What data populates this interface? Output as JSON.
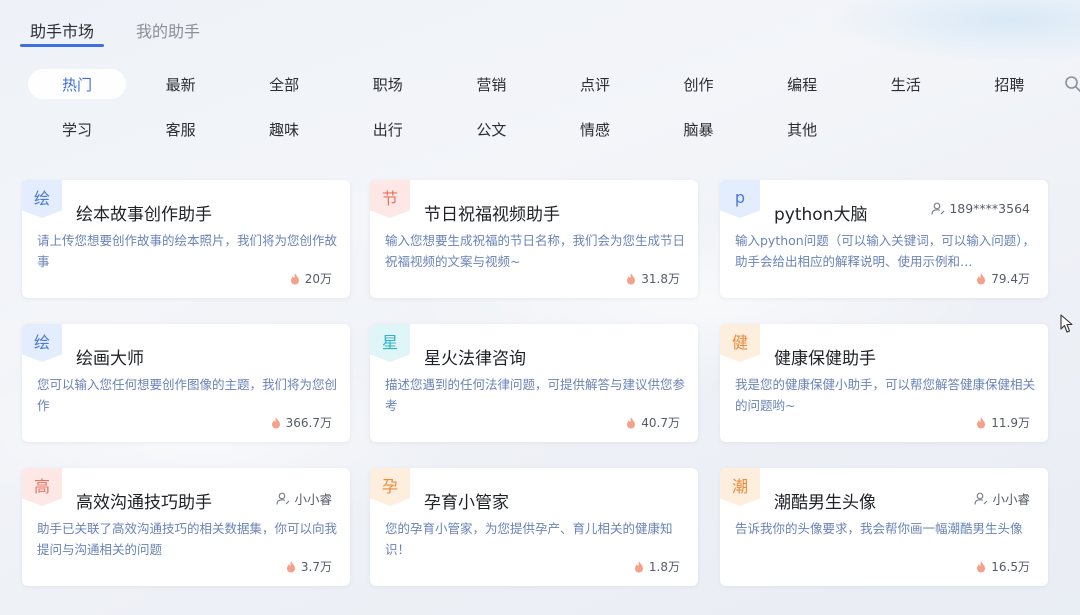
{
  "top_tabs": [
    {
      "label": "助手市场",
      "active": true
    },
    {
      "label": "我的助手",
      "active": false
    }
  ],
  "categories_row1": [
    "热门",
    "最新",
    "全部",
    "职场",
    "营销",
    "点评",
    "创作",
    "编程",
    "生活",
    "招聘"
  ],
  "categories_row2": [
    "学习",
    "客服",
    "趣味",
    "出行",
    "公文",
    "情感",
    "脑暴",
    "其他"
  ],
  "active_category": "热门",
  "colors": {
    "accent": "#3e6fe0",
    "desc": "#6a83b8",
    "fire": "#f4a08a",
    "badge_blue_bg": "#e4edfd",
    "badge_blue_fg": "#4a78d8",
    "badge_pink_bg": "#fde8e6",
    "badge_pink_fg": "#ea7060",
    "badge_cyan_bg": "#dff5f8",
    "badge_cyan_fg": "#2fb2c8",
    "badge_orange_bg": "#fdeedd",
    "badge_orange_fg": "#ec8a3a"
  },
  "cards": [
    {
      "badge": "绘",
      "badge_color": "blue",
      "title": "绘本故事创作助手",
      "desc": "请上传您想要创作故事的绘本照片，我们将为您创作故事",
      "author": "",
      "count": "20万"
    },
    {
      "badge": "节",
      "badge_color": "pink",
      "title": "节日祝福视频助手",
      "desc": "输入您想要生成祝福的节日名称，我们会为您生成节日祝福视频的文案与视频~",
      "author": "",
      "count": "31.8万"
    },
    {
      "badge": "p",
      "badge_color": "blue",
      "title": "python大脑",
      "desc": "输入python问题（可以输入关键词，可以输入问题），助手会给出相应的解释说明、使用示例和…",
      "author": "189****3564",
      "count": "79.4万"
    },
    {
      "badge": "绘",
      "badge_color": "blue",
      "title": "绘画大师",
      "desc": "您可以输入您任何想要创作图像的主题，我们将为您创作",
      "author": "",
      "count": "366.7万"
    },
    {
      "badge": "星",
      "badge_color": "cyan",
      "title": "星火法律咨询",
      "desc": "描述您遇到的任何法律问题，可提供解答与建议供您参考",
      "author": "",
      "count": "40.7万"
    },
    {
      "badge": "健",
      "badge_color": "orange",
      "title": "健康保健助手",
      "desc": "我是您的健康保健小助手，可以帮您解答健康保健相关的问题哟~",
      "author": "",
      "count": "11.9万"
    },
    {
      "badge": "高",
      "badge_color": "pink",
      "title": "高效沟通技巧助手",
      "desc": "助手已关联了高效沟通技巧的相关数据集，你可以向我提问与沟通相关的问题",
      "author": "小小睿",
      "count": "3.7万"
    },
    {
      "badge": "孕",
      "badge_color": "orange",
      "title": "孕育小管家",
      "desc": "您的孕育小管家，为您提供孕产、育儿相关的健康知识！",
      "author": "",
      "count": "1.8万"
    },
    {
      "badge": "潮",
      "badge_color": "orange",
      "title": "潮酷男生头像",
      "desc": "告诉我你的头像要求，我会帮你画一幅潮酷男生头像",
      "author": "小小睿",
      "count": "16.5万"
    }
  ]
}
